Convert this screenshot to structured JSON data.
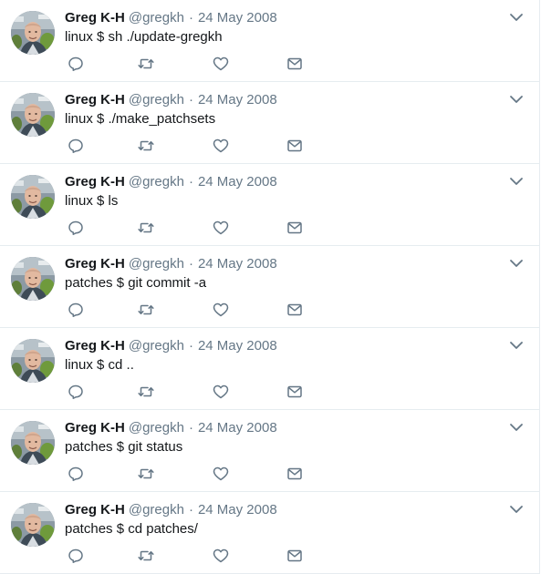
{
  "author": {
    "name": "Greg K-H",
    "handle": "@gregkh",
    "avatar_icon": "avatar-photo"
  },
  "separator": "·",
  "colors": {
    "text": "#14171a",
    "muted": "#657786",
    "divider": "#e6ecf0",
    "icon": "#657786"
  },
  "icons": {
    "reply": "reply-icon",
    "retweet": "retweet-icon",
    "like": "like-icon",
    "dm": "direct-message-icon",
    "caret": "chevron-down-icon"
  },
  "tweets": [
    {
      "date": "24 May 2008",
      "text": "linux $ sh ./update-gregkh"
    },
    {
      "date": "24 May 2008",
      "text": "linux $ ./make_patchsets"
    },
    {
      "date": "24 May 2008",
      "text": "linux $ ls"
    },
    {
      "date": "24 May 2008",
      "text": "patches $ git commit -a"
    },
    {
      "date": "24 May 2008",
      "text": "linux $ cd .."
    },
    {
      "date": "24 May 2008",
      "text": "patches $ git status"
    },
    {
      "date": "24 May 2008",
      "text": "patches $ cd patches/"
    }
  ]
}
